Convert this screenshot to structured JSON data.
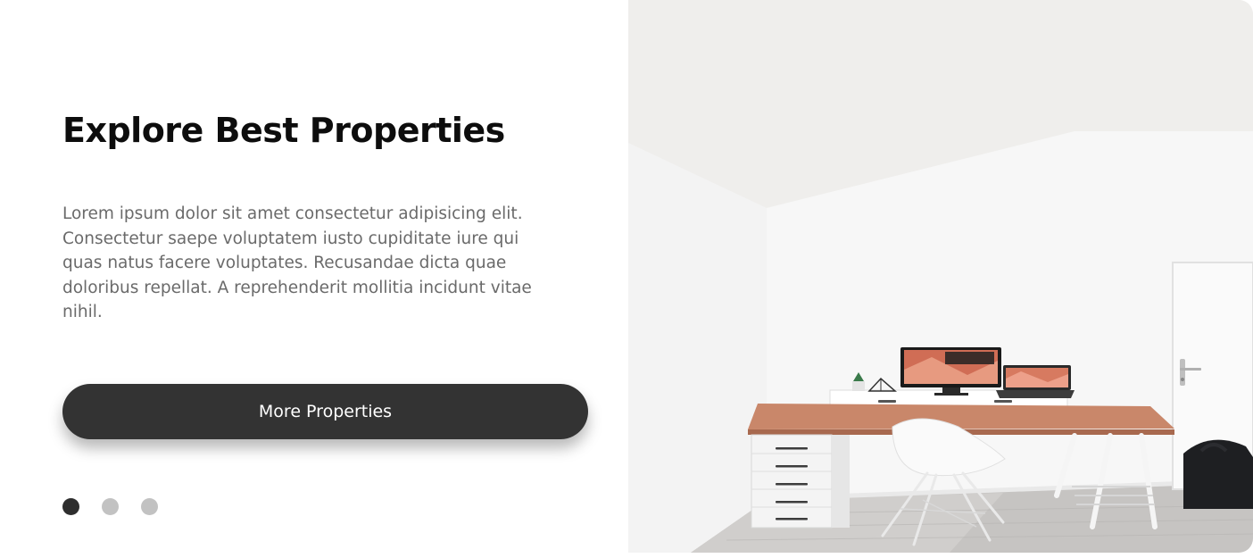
{
  "hero": {
    "title": "Explore Best Properties",
    "description": "Lorem ipsum dolor sit amet consectetur adipisicing elit. Consectetur saepe voluptatem iusto cupiditate iure qui quas natus facere voluptates. Recusandae dicta quae doloribus repellat. A reprehenderit mollitia incidunt vitae nihil.",
    "button_label": "More Properties"
  },
  "carousel": {
    "slide_count": 3,
    "active_index": 0
  },
  "colors": {
    "button_bg": "#333333",
    "dot_active": "#2e2e2e",
    "dot_inactive": "#c2c2c2",
    "title": "#0d0d0d",
    "body_text": "#6a6a6a",
    "desk_top": "#c9876a"
  },
  "photo": {
    "subject": "minimal white home office with wooden desk and monitors"
  }
}
